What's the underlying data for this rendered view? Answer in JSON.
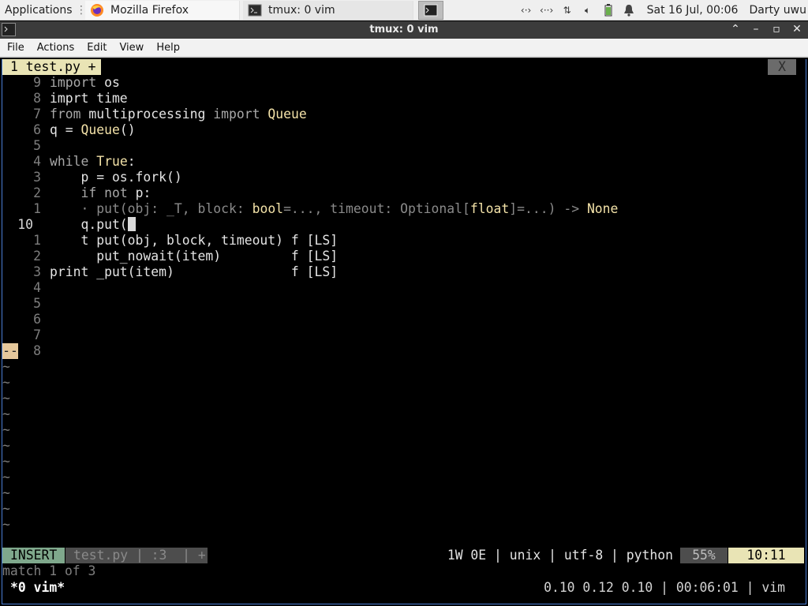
{
  "panel": {
    "applications_label": "Applications",
    "tasks": [
      {
        "label": "Mozilla Firefox",
        "icon": "firefox-icon"
      },
      {
        "label": "tmux: 0 vim",
        "icon": "terminal-icon"
      }
    ],
    "clock": "Sat 16 Jul, 00:06",
    "user": "Darty uwu"
  },
  "window": {
    "title": "tmux: 0 vim",
    "menu": [
      "File",
      "Actions",
      "Edit",
      "View",
      "Help"
    ]
  },
  "vim": {
    "tab_label": "1 test.py +",
    "tab_close": "X",
    "lines": [
      {
        "num": "9",
        "text": "import os"
      },
      {
        "num": "8",
        "text": "imprt time"
      },
      {
        "num": "7",
        "text": "from multiprocessing import Queue"
      },
      {
        "num": "6",
        "text": "q = Queue()"
      },
      {
        "num": "5",
        "text": ""
      },
      {
        "num": "4",
        "text": "while True:"
      },
      {
        "num": "3",
        "text": "    p = os.fork()"
      },
      {
        "num": "2",
        "text": "    if not p:"
      },
      {
        "num": "1",
        "text": "    · put(obj: _T, block: bool=..., timeout: Optional[float]=...) -> None"
      },
      {
        "num": "10",
        "text": "    q.put("
      },
      {
        "num": "1",
        "text": "    t put(obj, block, timeout) f [LS]"
      },
      {
        "num": "2",
        "text": "      put_nowait(item)         f [LS]"
      },
      {
        "num": "3",
        "text": "print _put(item)               f [LS]"
      },
      {
        "num": "4",
        "text": ""
      },
      {
        "num": "5",
        "text": ""
      },
      {
        "num": "6",
        "text": ""
      },
      {
        "num": "7",
        "text": ""
      },
      {
        "num": "8",
        "text": ""
      }
    ],
    "sign_marker": "--",
    "tilde": "~",
    "status": {
      "mode": "INSERT",
      "file": "test.py | :3  | +",
      "info": "1W 0E | unix | utf-8 | python",
      "percent": "55%",
      "position": "10:11"
    },
    "message": "match 1 of 3"
  },
  "tmux": {
    "window": "*0 vim*",
    "right": "0.10 0.12 0.10 | 00:06:01 | vim"
  }
}
